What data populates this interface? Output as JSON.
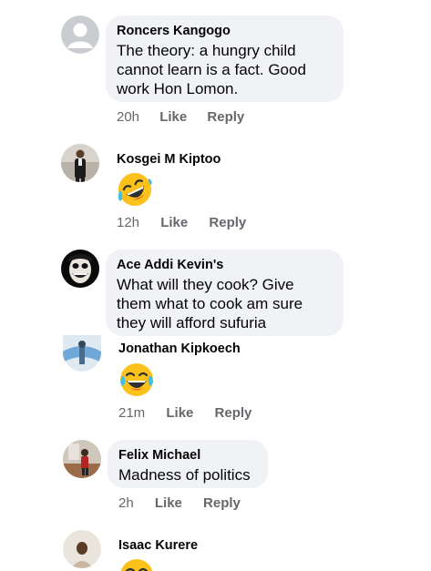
{
  "comments": [
    {
      "author": "Roncers Kangogo",
      "text": "The theory: a hungry child cannot learn is a fact. Good work Hon Lomon.",
      "time": "20h",
      "like": "Like",
      "reply": "Reply",
      "avatar": "default-profile-avatar"
    },
    {
      "author": "Kosgei M Kiptoo",
      "emoji": "rolling-on-floor-laughing-emoji",
      "time": "12h",
      "like": "Like",
      "reply": "Reply",
      "avatar": "person-in-suit-avatar"
    },
    {
      "author": "Ace Addi Kevin's",
      "text": "What will they cook? Give them what to cook am sure they will afford sufuria",
      "avatar": "creepy-face-avatar"
    },
    {
      "author": "Jonathan Kipkoech",
      "emoji": "tears-of-joy-emoji",
      "time": "21m",
      "like": "Like",
      "reply": "Reply",
      "avatar": "photo-avatar"
    },
    {
      "author": "Felix Michael",
      "text": "Madness of politics",
      "time": "2h",
      "like": "Like",
      "reply": "Reply",
      "avatar": "photo-avatar"
    },
    {
      "author": "Isaac Kurere",
      "emoji": "laughing-emoji",
      "avatar": "person-photo-avatar"
    }
  ],
  "colors": {
    "bubble": "#f0f2f5",
    "meta_text": "#65676b",
    "name_text": "#050505"
  }
}
